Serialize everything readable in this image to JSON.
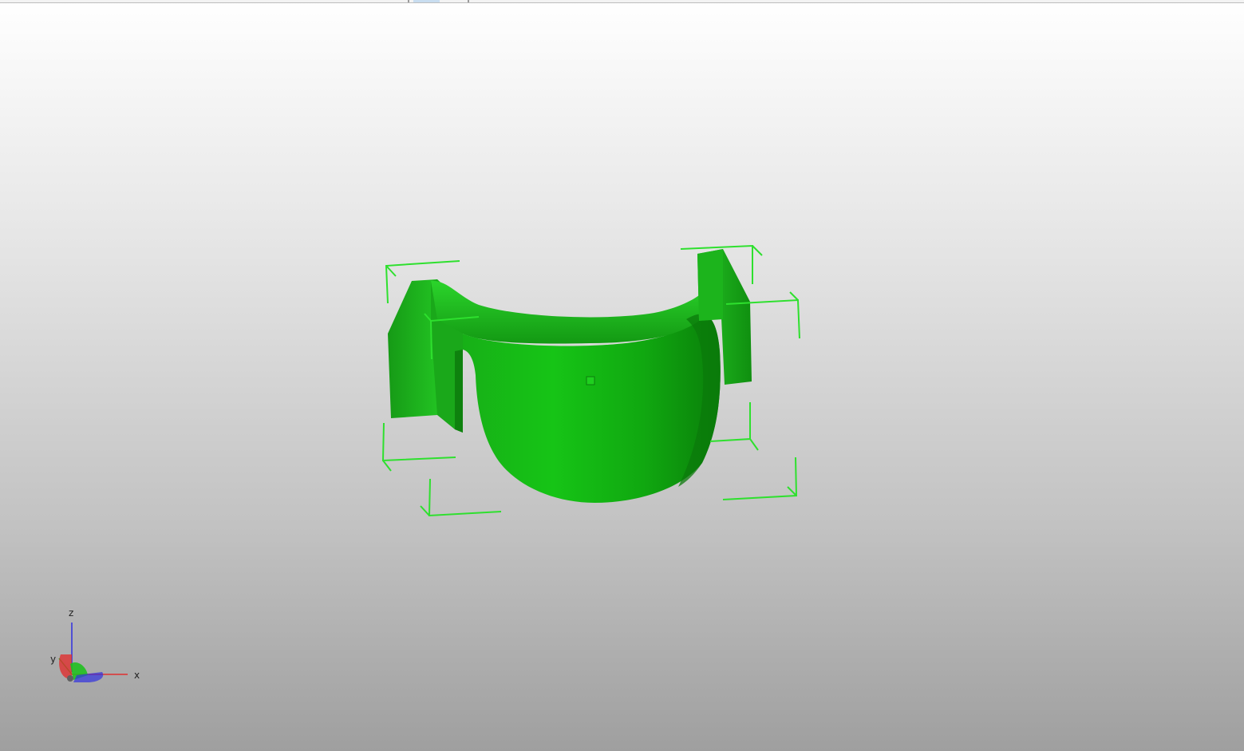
{
  "viewport": {
    "background_top": "#ffffff",
    "background_bottom": "#9f9f9f"
  },
  "model": {
    "color": "#1ec81e",
    "selection_color": "#22dd22",
    "selected": true
  },
  "axis_triad": {
    "x_label": "x",
    "y_label": "y",
    "z_label": "z",
    "x_color": "#e03030",
    "y_color": "#20b020",
    "z_color": "#3030e0"
  }
}
